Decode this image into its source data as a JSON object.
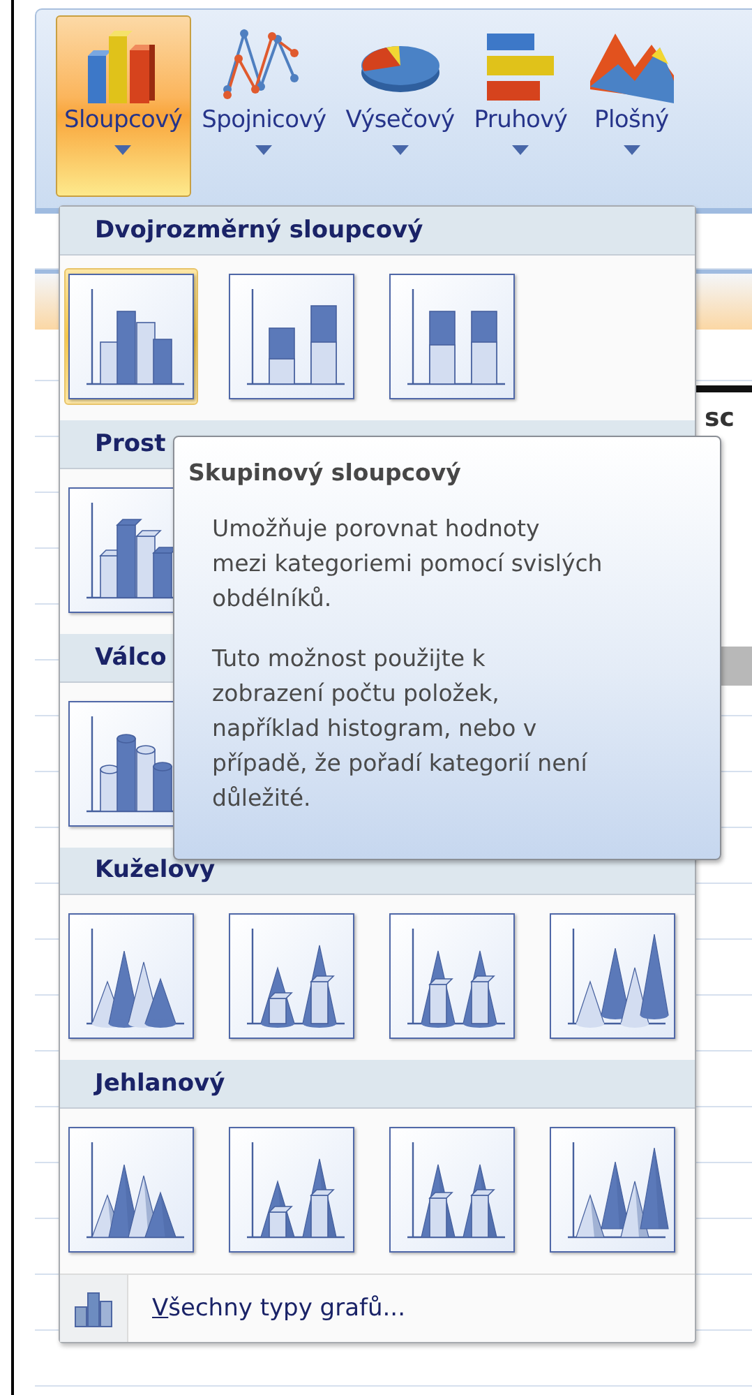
{
  "ribbon": {
    "buttons": [
      {
        "label": "Sloupcový",
        "kind": "column",
        "selected": true
      },
      {
        "label": "Spojnicový",
        "kind": "line",
        "selected": false
      },
      {
        "label": "Výsečový",
        "kind": "pie",
        "selected": false
      },
      {
        "label": "Pruhový",
        "kind": "bar",
        "selected": false
      },
      {
        "label": "Plošný",
        "kind": "area",
        "selected": false
      }
    ]
  },
  "sheet": {
    "cell_fragment": "sc"
  },
  "menu": {
    "sections": [
      {
        "title": "Dvojrozměrný sloupcový",
        "kind": "flat",
        "items": [
          {
            "kind": "clustered",
            "selected": true
          },
          {
            "kind": "stacked",
            "selected": false
          },
          {
            "kind": "percent",
            "selected": false
          }
        ]
      },
      {
        "title": "Prost",
        "kind": "block",
        "items": [
          {
            "kind": "clustered",
            "selected": false
          }
        ]
      },
      {
        "title": "Válco",
        "kind": "cylinder",
        "items": [
          {
            "kind": "clustered",
            "selected": false
          }
        ]
      },
      {
        "title": "Kuželovy",
        "kind": "cone",
        "items": [
          {
            "kind": "clustered",
            "selected": false
          },
          {
            "kind": "stacked",
            "selected": false
          },
          {
            "kind": "percent",
            "selected": false
          },
          {
            "kind": "depth",
            "selected": false
          }
        ]
      },
      {
        "title": "Jehlanový",
        "kind": "pyramid",
        "items": [
          {
            "kind": "clustered",
            "selected": false
          },
          {
            "kind": "stacked",
            "selected": false
          },
          {
            "kind": "percent",
            "selected": false
          },
          {
            "kind": "depth",
            "selected": false
          }
        ]
      }
    ],
    "footer": {
      "access_key": "V",
      "label": "šechny typy grafů..."
    }
  },
  "tooltip": {
    "title": "Skupinový sloupcový",
    "paragraphs": [
      "Umožňuje porovnat hodnoty\nmezi kategoriemi pomocí svislých\nobdélníků.",
      "Tuto možnost použijte k\nzobrazení počtu položek,\nnapříklad histogram, nebo v\npřípadě, že pořadí kategorií není\ndůležité."
    ]
  }
}
